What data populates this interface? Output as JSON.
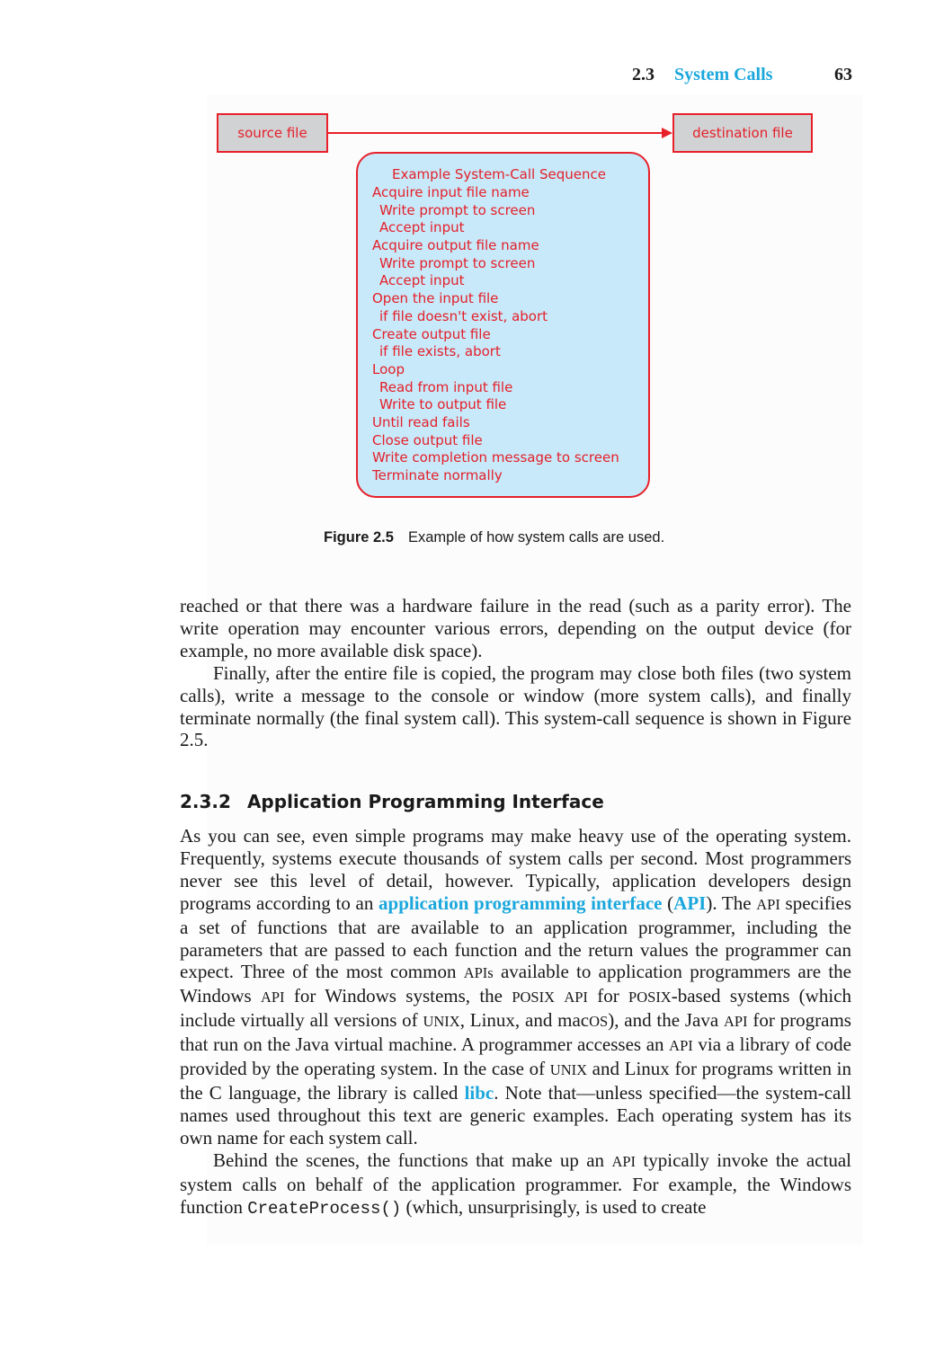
{
  "header": {
    "section_number": "2.3",
    "section_title": "System Calls",
    "page_number": "63"
  },
  "figure": {
    "source_label": "source file",
    "destination_label": "destination file",
    "sequence_title": "Example System-Call Sequence",
    "sequence_steps": [
      {
        "text": "Acquire input file name",
        "indent": false
      },
      {
        "text": "Write prompt to screen",
        "indent": true
      },
      {
        "text": "Accept input",
        "indent": true
      },
      {
        "text": "Acquire output file name",
        "indent": false
      },
      {
        "text": "Write prompt to screen",
        "indent": true
      },
      {
        "text": "Accept input",
        "indent": true
      },
      {
        "text": "Open the input file",
        "indent": false
      },
      {
        "text": "if file doesn't exist, abort",
        "indent": true
      },
      {
        "text": "Create output file",
        "indent": false
      },
      {
        "text": "if file exists, abort",
        "indent": true
      },
      {
        "text": "Loop",
        "indent": false
      },
      {
        "text": "Read from input file",
        "indent": true
      },
      {
        "text": "Write to output file",
        "indent": true
      },
      {
        "text": "Until read fails",
        "indent": false
      },
      {
        "text": "Close output file",
        "indent": false
      },
      {
        "text": "Write completion message to screen",
        "indent": false
      },
      {
        "text": "Terminate normally",
        "indent": false
      }
    ],
    "caption_label": "Figure 2.5",
    "caption_text": "Example of how system calls are used.",
    "colors": {
      "line": "#e8202a",
      "file_box_fill": "#d1d2d4",
      "sequence_fill": "#c8e9f9"
    }
  },
  "paragraphs_top": [
    "reached or that there was a hardware failure in the read (such as a parity error). The write operation may encounter various errors, depending on the output device (for example, no more available disk space).",
    "Finally, after the entire file is copied, the program may close both files (two system calls), write a message to the console or window (more system calls), and finally terminate normally (the final system call). This system-call sequence is shown in Figure 2.5."
  ],
  "subsection": {
    "number": "2.3.2",
    "title": "Application Programming Interface"
  },
  "api_paragraph": {
    "s1": "As you can see, even simple programs may make heavy use of the operating system. Frequently, systems execute thousands of system calls per second. Most programmers never see this level of detail, however. Typically, application developers design programs according to an ",
    "term1": "application programming interface",
    "s2": " (",
    "term2": "API",
    "s3": "). The ",
    "api": "API",
    "s4": " specifies a set of functions that are available to an application programmer, including the parameters that are passed to each function and the return values the programmer can expect. Three of the most common ",
    "apis": "APIs",
    "s5": " available to application programmers are the Windows ",
    "s6": " for Windows systems, the ",
    "posix": "POSIX",
    "s7": " for ",
    "s8": "-based systems (which include virtually all versions of ",
    "unix": "UNIX",
    "s9": ", Linux, and mac",
    "os": "OS",
    "s10": "), and the Java ",
    "s11": " for programs that run on the Java virtual machine. A programmer accesses an ",
    "s12": " via a library of code provided by the operating system. In the case of ",
    "s13": " and Linux for programs written in the C language, the library is called ",
    "term3": "libc",
    "s14": ". Note that—unless specified—the system-call names used throughout this text are generic examples. Each operating system has its own name for each system call."
  },
  "last_paragraph": {
    "s1": "Behind the scenes, the functions that make up an ",
    "api": "API",
    "s2": " typically invoke the actual system calls on behalf of the application programmer. For example, the Windows function ",
    "code": "CreateProcess()",
    "s3": " (which, unsurprisingly, is used to create"
  }
}
